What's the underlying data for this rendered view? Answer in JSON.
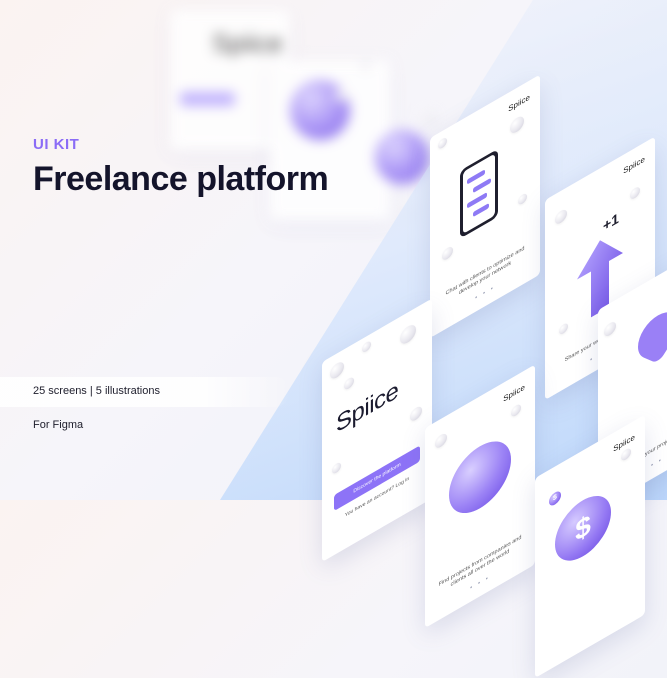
{
  "kit_label": "UI KIT",
  "title": "Freelance platform",
  "stats": "25 screens | 5 illustrations",
  "platform": "For Figma",
  "brand_name": "Spiice",
  "phones": {
    "chat_caption": "Chat with clients to optimize and develop your network",
    "ship_caption": "Share your work and earn xp",
    "world_caption": "Find projects from companies and clients all over the world",
    "enjoy_caption": "Enjoy your projects",
    "plus_one": "+1",
    "login_button": "Discover the platform",
    "login_link": "You have an account? Log in",
    "coin_symbol": "$"
  },
  "colors": {
    "accent": "#8b6cf6",
    "title": "#14142b",
    "diagonal": "#bcd7fb"
  }
}
